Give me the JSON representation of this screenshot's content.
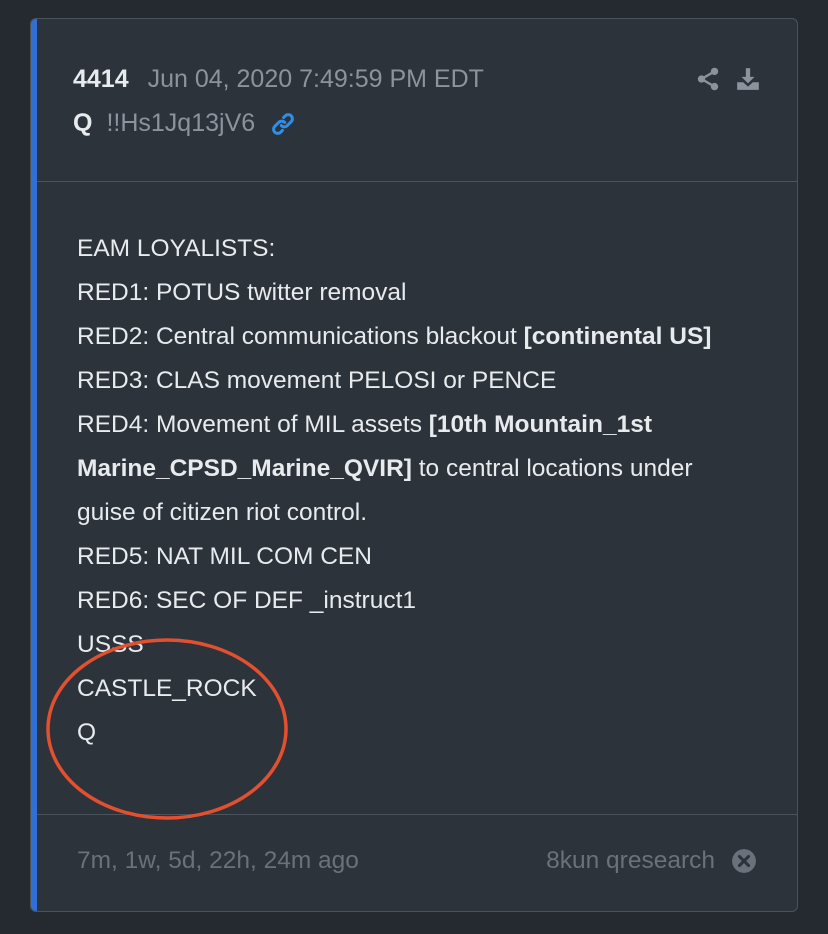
{
  "post": {
    "number": "4414",
    "date": "Jun 04, 2020 7:49:59 PM EDT",
    "author": "Q",
    "tripcode": "!!Hs1Jq13jV6"
  },
  "icons": {
    "link": "link-icon",
    "share": "share-icon",
    "download": "download-icon",
    "close": "close-circle-icon"
  },
  "content": {
    "line1": "EAM LOYALISTS:",
    "line2": "RED1: POTUS twitter removal",
    "line3a": "RED2: Central communications blackout ",
    "line3b": "[continental US]",
    "line4": "RED3: CLAS movement PELOSI or PENCE",
    "line5a": "RED4: Movement of MIL assets ",
    "line5b": "[10th Mountain_1st Marine_CPSD_Marine_QVIR]",
    "line5c": " to central locations under guise of citizen riot control.",
    "line6": "RED5: NAT MIL COM CEN",
    "line7": "RED6: SEC OF DEF _instruct1",
    "line8": "USSS",
    "line9": "CASTLE_ROCK",
    "line10": "Q"
  },
  "footer": {
    "relative_time": "7m, 1w, 5d, 22h, 24m ago",
    "source": "8kun qresearch"
  },
  "colors": {
    "background": "#252a31",
    "card": "#2d333b",
    "accent": "#2f6fd6",
    "link": "#2f8ee8",
    "annotation": "#e2502f"
  }
}
